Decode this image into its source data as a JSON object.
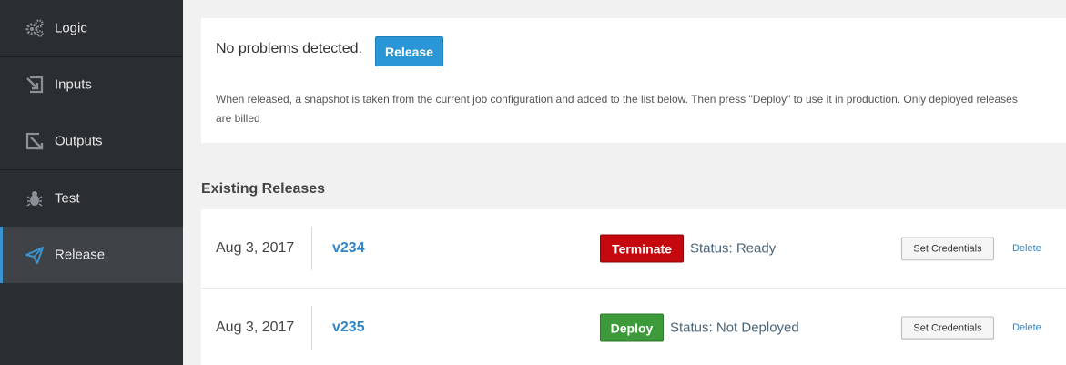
{
  "sidebar": {
    "items": [
      {
        "label": "Logic",
        "icon": "gears-icon",
        "active": false
      },
      {
        "label": "Inputs",
        "icon": "input-arrow-icon",
        "active": false
      },
      {
        "label": "Outputs",
        "icon": "output-arrow-icon",
        "active": false
      },
      {
        "label": "Test",
        "icon": "bug-icon",
        "active": false
      },
      {
        "label": "Release",
        "icon": "paper-plane-icon",
        "active": true
      }
    ]
  },
  "release_panel": {
    "status_text": "No problems detected.",
    "release_button": "Release",
    "note": "When released, a snapshot is taken from the current job configuration and added to the list below. Then press \"Deploy\" to use it in production. Only deployed releases are billed"
  },
  "existing": {
    "title": "Existing Releases",
    "releases": [
      {
        "date": "Aug 3, 2017",
        "version": "v234",
        "action": "Terminate",
        "status": "Status: Ready",
        "credentials": "Set Credentials",
        "delete": "Delete"
      },
      {
        "date": "Aug 3, 2017",
        "version": "v235",
        "action": "Deploy",
        "status": "Status: Not Deployed",
        "credentials": "Set Credentials",
        "delete": "Delete"
      }
    ]
  },
  "colors": {
    "sidebar_bg": "#2b2e31",
    "active_bg": "#3f4347",
    "accent": "#3a93cf",
    "terminate": "#c4080d",
    "deploy": "#3d9a3a",
    "link": "#2f86c8"
  }
}
